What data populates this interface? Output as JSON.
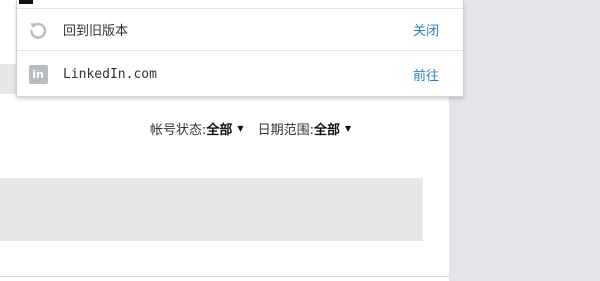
{
  "menu": {
    "items": [
      {
        "label": "回到旧版本",
        "action": "关闭",
        "icon": "revert-icon"
      },
      {
        "label": "LinkedIn.com",
        "action": "前往",
        "icon": "linkedin-icon",
        "icon_text": "in"
      }
    ]
  },
  "filters": {
    "account_status": {
      "label": "帐号状态:",
      "value": "全部"
    },
    "date_range": {
      "label": "日期范围:",
      "value": "全部"
    }
  },
  "colors": {
    "link": "#2f7fb8",
    "gutter": "#e4e6e9",
    "placeholder_bar": "#e6e7e9"
  }
}
